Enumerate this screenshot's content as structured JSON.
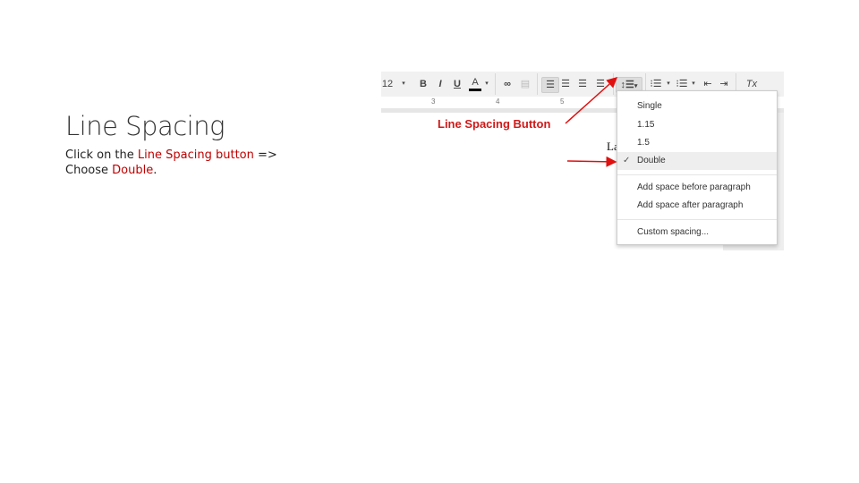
{
  "slide": {
    "title": "Line Spacing",
    "body_prefix": "Click on the ",
    "body_highlight1": "Line Spacing button",
    "body_mid": " =>",
    "body_line2_prefix": "Choose ",
    "body_highlight2": "Double",
    "body_suffix": ".",
    "highlight_color": "#c00000"
  },
  "toolbar": {
    "font_size": "12",
    "bold": "B",
    "italic": "I",
    "underline": "U",
    "text_color": "A",
    "clear_formatting": "Tx"
  },
  "ruler": [
    "3",
    "4",
    "5"
  ],
  "annotation": {
    "label": "Line Spacing Button",
    "color": "#d01818"
  },
  "document": {
    "text": "La"
  },
  "menu": {
    "items": [
      {
        "label": "Single"
      },
      {
        "label": "1.15"
      },
      {
        "label": "1.5"
      },
      {
        "label": "Double",
        "checked": true
      }
    ],
    "paragraph_items": [
      {
        "label": "Add space before paragraph"
      },
      {
        "label": "Add space after paragraph"
      }
    ],
    "custom": "Custom spacing..."
  }
}
